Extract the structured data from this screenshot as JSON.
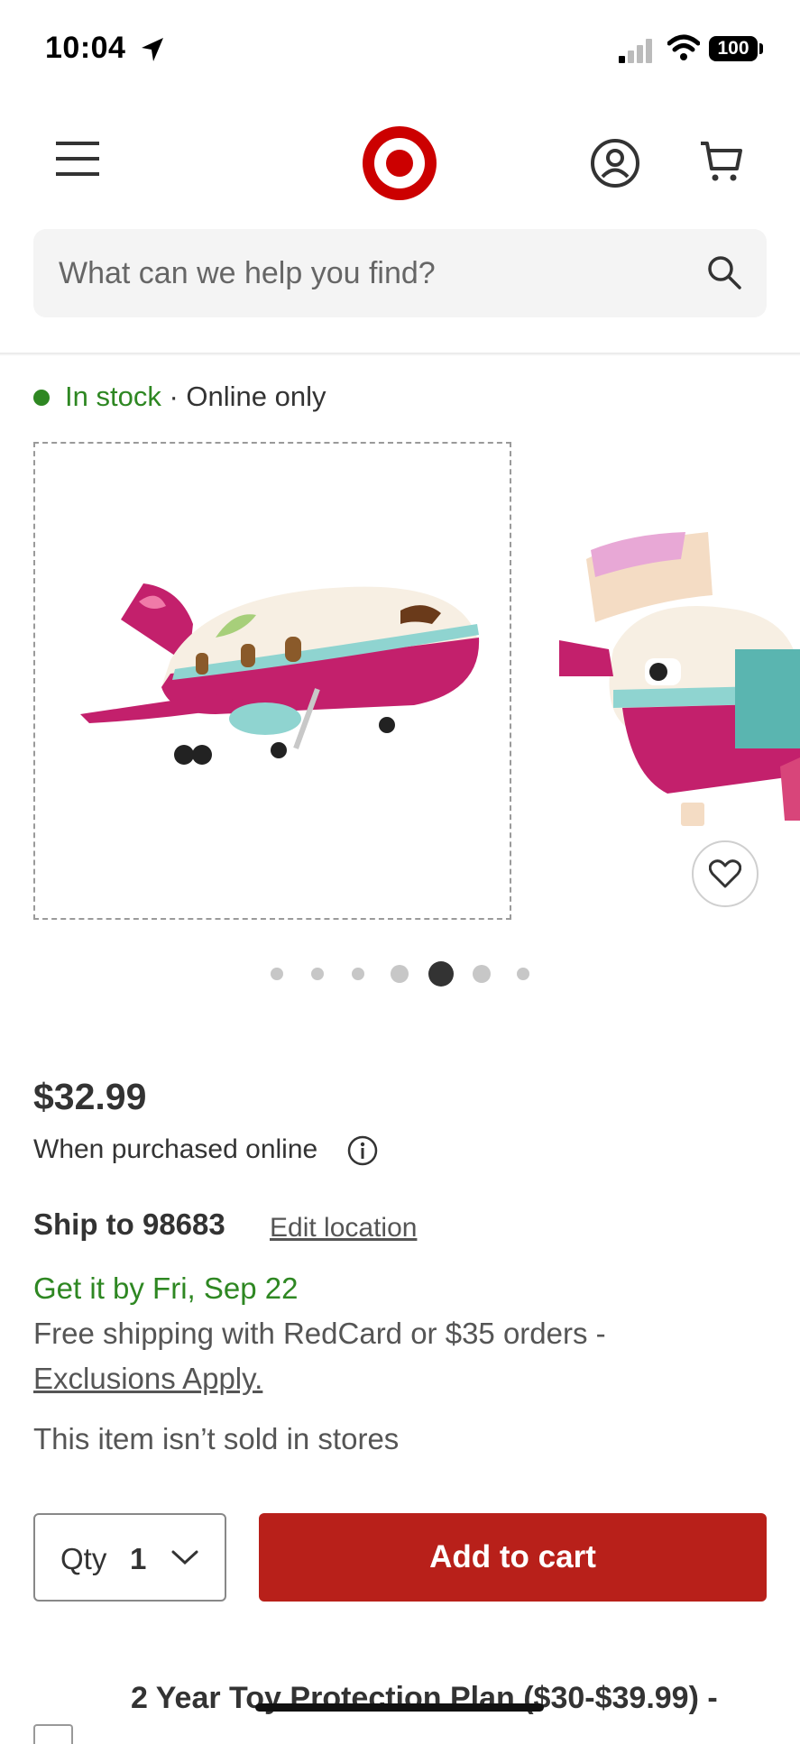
{
  "status_bar": {
    "time": "10:04",
    "battery": "100",
    "icons": [
      "location-arrow-icon",
      "signal-icon",
      "wifi-icon",
      "battery-icon"
    ]
  },
  "header": {
    "icons": [
      "menu-icon",
      "target-logo",
      "account-icon",
      "cart-icon"
    ],
    "brand_color": "#cc0000"
  },
  "search": {
    "placeholder": "What can we help you find?",
    "icon": "search-icon"
  },
  "product": {
    "stock_status": "In stock",
    "stock_suffix": " · Online only",
    "carousel": {
      "dot_count": 7,
      "active_index": 4
    },
    "price": "$32.99",
    "price_note": "When purchased online",
    "ship_to": "Ship to 98683",
    "edit_location": "Edit location",
    "delivery_date": "Get it by Fri, Sep 22",
    "shipping_info": "Free shipping with RedCard or $35 orders -",
    "exclusions_link": "Exclusions Apply.",
    "store_note": "This item isn’t sold in stores",
    "qty_label": "Qty",
    "qty_value": "1",
    "add_to_cart": "Add to cart",
    "protection_plan": "2 Year Toy Protection Plan ($30-$39.99) -"
  },
  "colors": {
    "accent_red": "#b8201a",
    "in_stock_green": "#2e8722"
  }
}
